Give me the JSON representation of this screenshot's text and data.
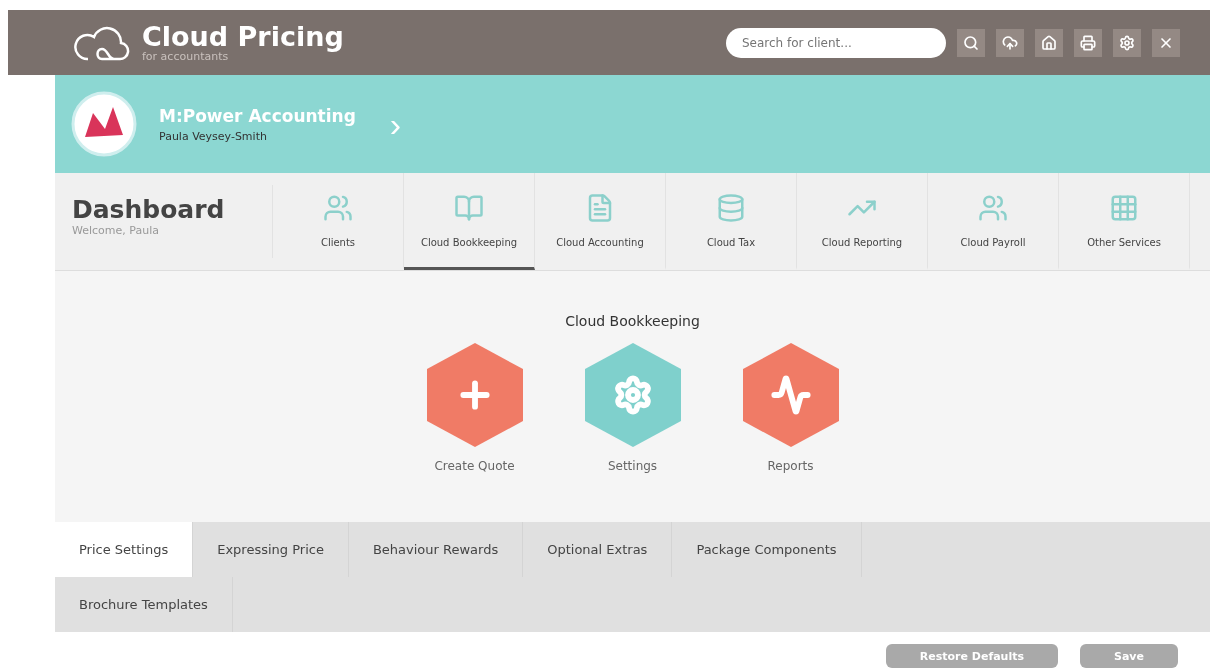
{
  "brand": {
    "title": "Cloud Pricing",
    "subtitle": "for accountants"
  },
  "search": {
    "placeholder": "Search for client..."
  },
  "toolbar": [
    {
      "kind": "search"
    },
    {
      "kind": "cloud"
    },
    {
      "kind": "home"
    },
    {
      "kind": "print"
    },
    {
      "kind": "settings"
    },
    {
      "kind": "close"
    }
  ],
  "client": {
    "name": "M:Power Accounting",
    "contact": "Paula Veysey-Smith",
    "arrow": "›"
  },
  "dashboard": {
    "title": "Dashboard",
    "welcome": "Welcome, Paula"
  },
  "nav": [
    {
      "label": "Clients",
      "selected": false
    },
    {
      "label": "Cloud Bookkeeping",
      "selected": true
    },
    {
      "label": "Cloud Accounting",
      "selected": false
    },
    {
      "label": "Cloud Tax",
      "selected": false
    },
    {
      "label": "Cloud Reporting",
      "selected": false
    },
    {
      "label": "Cloud Payroll",
      "selected": false
    },
    {
      "label": "Other Services",
      "selected": false
    }
  ],
  "section": {
    "title": "Cloud Bookkeeping",
    "actions": [
      {
        "label": "Create Quote",
        "color": "#f07b66"
      },
      {
        "label": "Settings",
        "color": "#7fd0cc"
      },
      {
        "label": "Reports",
        "color": "#f07b66"
      }
    ]
  },
  "tabs": [
    {
      "label": "Price Settings",
      "selected": true
    },
    {
      "label": "Expressing Price",
      "selected": false
    },
    {
      "label": "Behaviour Rewards",
      "selected": false
    },
    {
      "label": "Optional Extras",
      "selected": false
    },
    {
      "label": "Package Components",
      "selected": false
    },
    {
      "label": "Brochure Templates",
      "selected": false
    }
  ],
  "buttons": [
    {
      "label": "Restore Defaults"
    },
    {
      "label": "Save"
    }
  ]
}
